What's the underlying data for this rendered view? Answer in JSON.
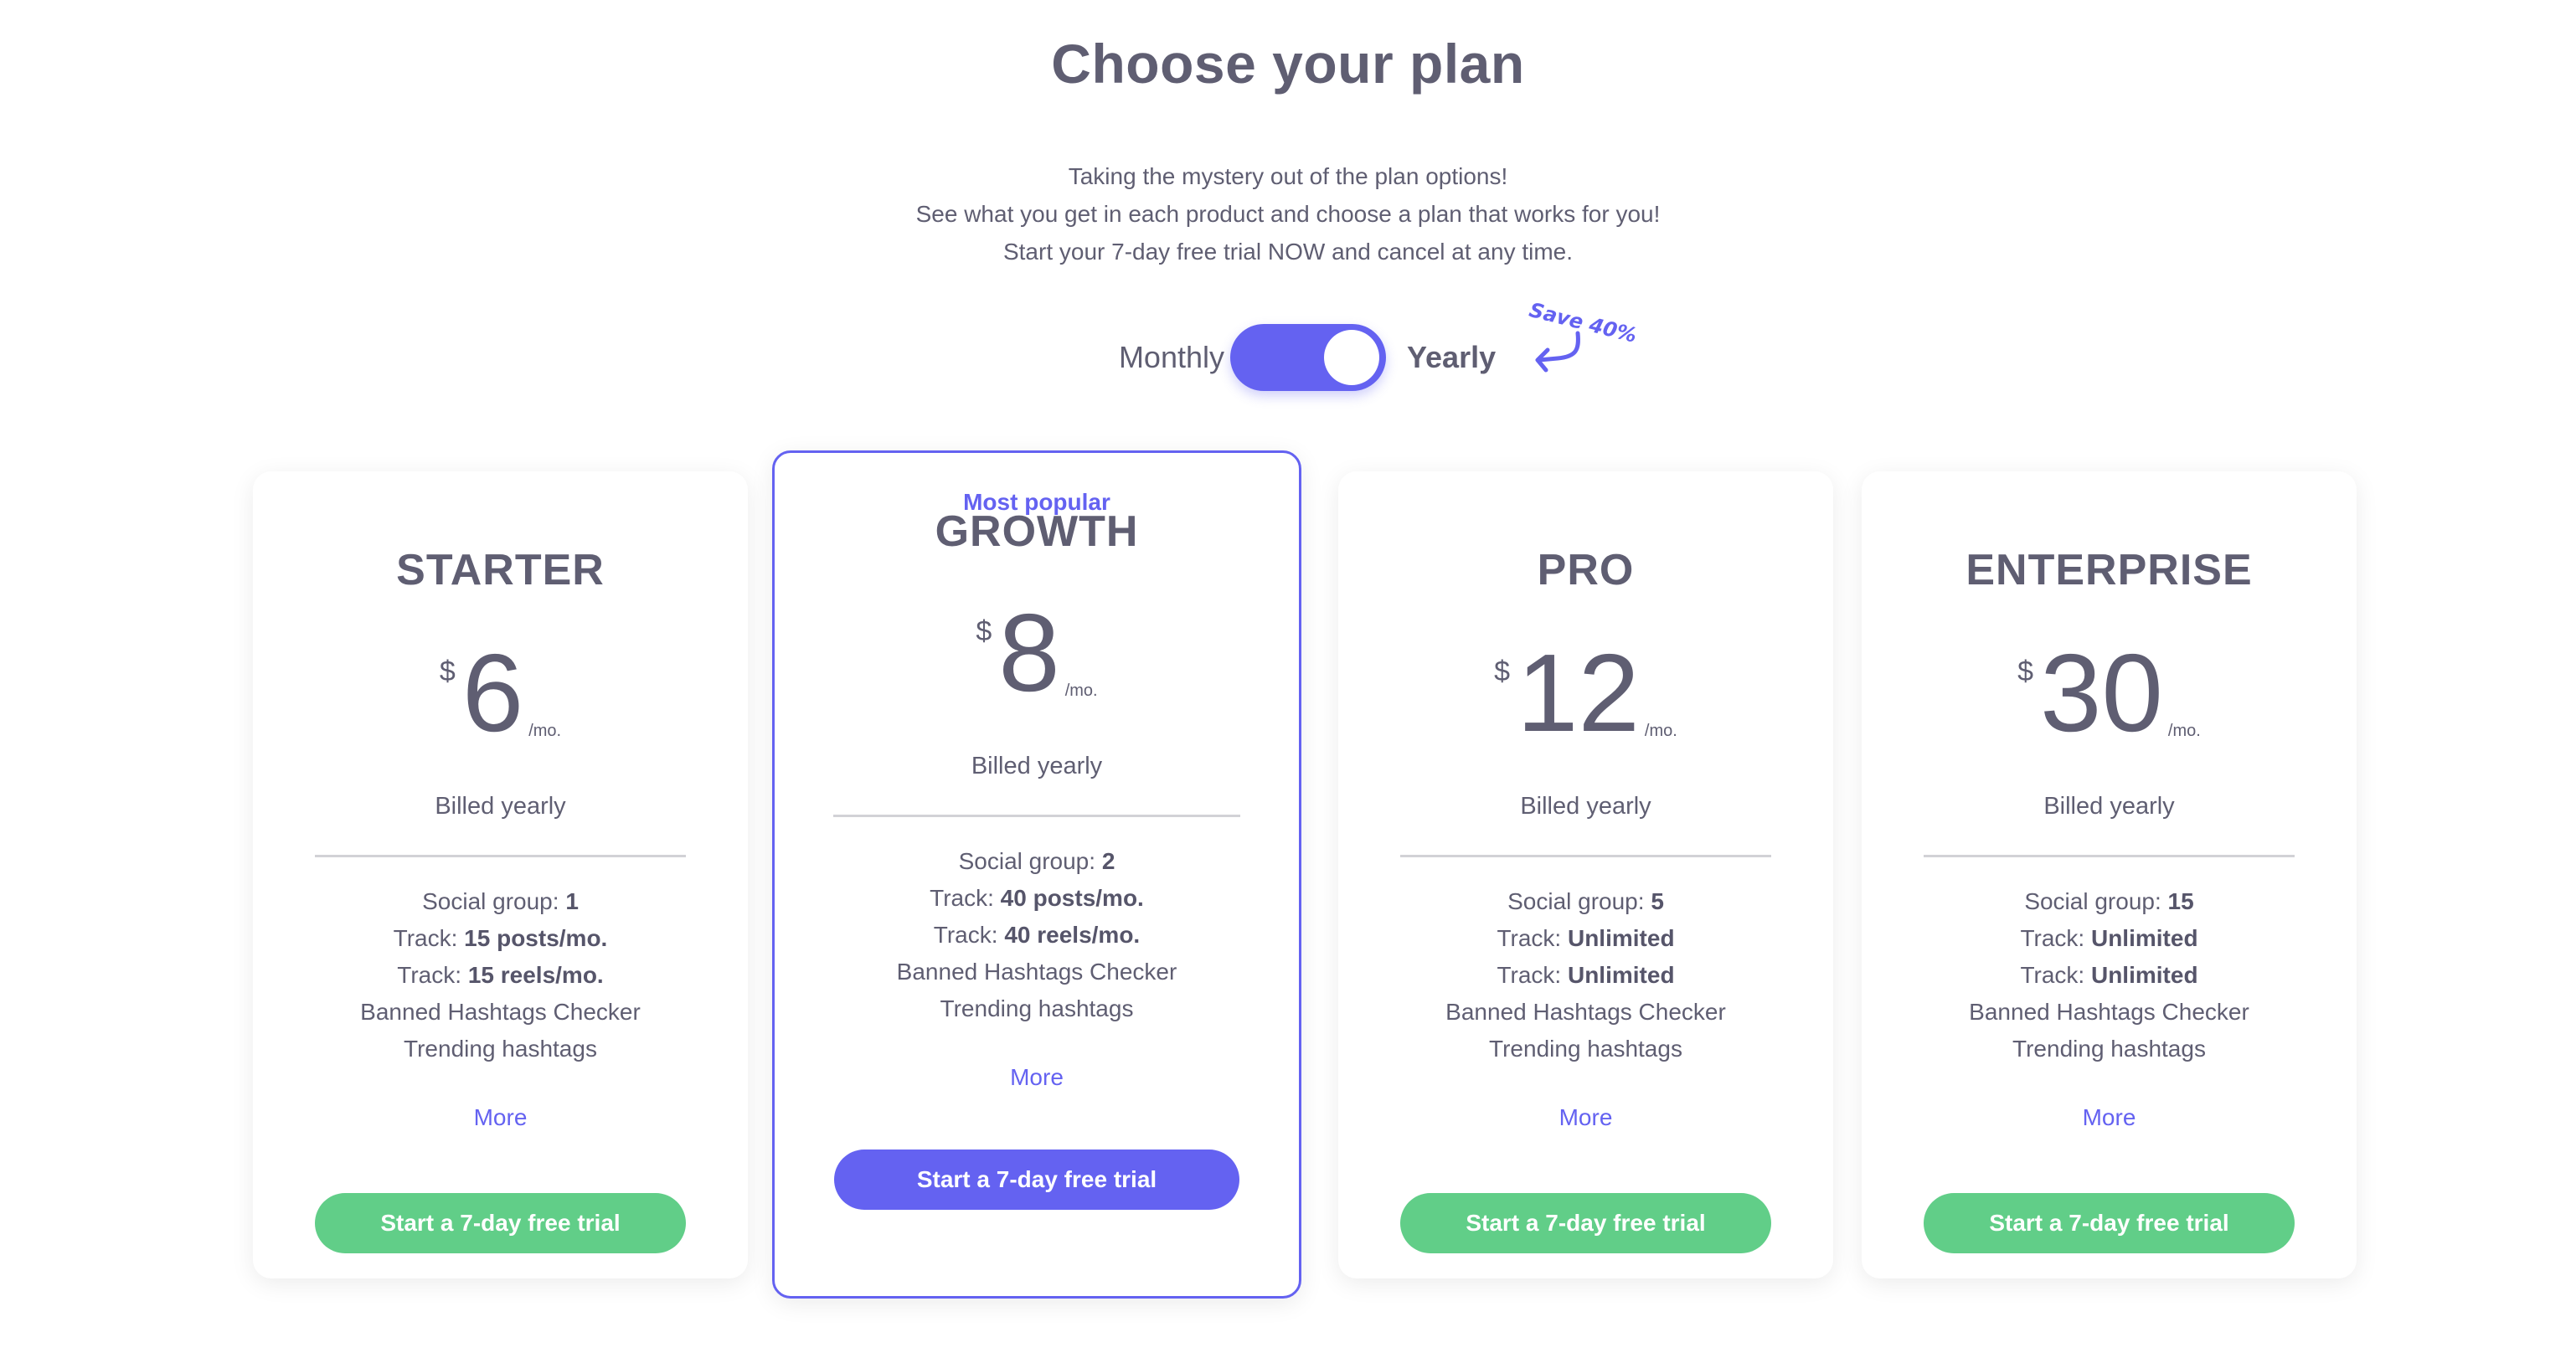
{
  "header": {
    "title": "Choose your plan",
    "subtitle_lines": [
      "Taking the mystery out of the plan options!",
      "See what you get in each product and choose a plan that works for you!",
      "Start your 7-day free trial NOW and cancel at any time."
    ]
  },
  "billing": {
    "monthly_label": "Monthly",
    "yearly_label": "Yearly",
    "selected": "Yearly",
    "save_note": "Save 40%"
  },
  "colors": {
    "accent": "#6462f1",
    "cta_green": "#61ce88",
    "text": "#5f5e72"
  },
  "plans": [
    {
      "name": "STARTER",
      "badge": "",
      "currency": "$",
      "price": "6",
      "period": "/mo.",
      "billed": "Billed yearly",
      "features": [
        {
          "label": "Social group: ",
          "value": "1"
        },
        {
          "label": "Track: ",
          "value": "15 posts/mo."
        },
        {
          "label": "Track: ",
          "value": "15 reels/mo."
        },
        {
          "label": "Banned Hashtags Checker",
          "value": ""
        },
        {
          "label": "Trending hashtags",
          "value": ""
        }
      ],
      "more": "More",
      "cta": "Start a 7-day free trial"
    },
    {
      "name": "GROWTH",
      "badge": "Most popular",
      "currency": "$",
      "price": "8",
      "period": "/mo.",
      "billed": "Billed yearly",
      "features": [
        {
          "label": "Social group: ",
          "value": "2"
        },
        {
          "label": "Track: ",
          "value": "40 posts/mo."
        },
        {
          "label": "Track: ",
          "value": "40 reels/mo."
        },
        {
          "label": "Banned Hashtags Checker",
          "value": ""
        },
        {
          "label": "Trending hashtags",
          "value": ""
        }
      ],
      "more": "More",
      "cta": "Start a 7-day free trial"
    },
    {
      "name": "PRO",
      "badge": "",
      "currency": "$",
      "price": "12",
      "period": "/mo.",
      "billed": "Billed yearly",
      "features": [
        {
          "label": "Social group: ",
          "value": "5"
        },
        {
          "label": "Track: ",
          "value": "Unlimited"
        },
        {
          "label": "Track: ",
          "value": "Unlimited"
        },
        {
          "label": "Banned Hashtags Checker",
          "value": ""
        },
        {
          "label": "Trending hashtags",
          "value": ""
        }
      ],
      "more": "More",
      "cta": "Start a 7-day free trial"
    },
    {
      "name": "ENTERPRISE",
      "badge": "",
      "currency": "$",
      "price": "30",
      "period": "/mo.",
      "billed": "Billed yearly",
      "features": [
        {
          "label": "Social group: ",
          "value": "15"
        },
        {
          "label": "Track: ",
          "value": "Unlimited"
        },
        {
          "label": "Track: ",
          "value": "Unlimited"
        },
        {
          "label": "Banned Hashtags Checker",
          "value": ""
        },
        {
          "label": "Trending hashtags",
          "value": ""
        }
      ],
      "more": "More",
      "cta": "Start a 7-day free trial"
    }
  ]
}
